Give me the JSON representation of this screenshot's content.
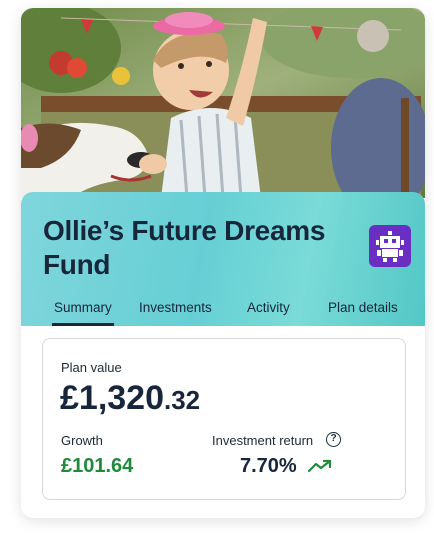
{
  "fund": {
    "title": "Ollie’s Future Dreams Fund",
    "badge_icon": "robot-icon",
    "badge_color": "#6a2fc2"
  },
  "tabs": [
    {
      "label": "Summary",
      "active": true
    },
    {
      "label": "Investments",
      "active": false
    },
    {
      "label": "Activity",
      "active": false
    },
    {
      "label": "Plan details",
      "active": false
    }
  ],
  "summary": {
    "plan_value_label": "Plan value",
    "plan_value_major": "£1,320",
    "plan_value_minor": ".32",
    "growth_label": "Growth",
    "growth_value": "£101.64",
    "growth_color": "#1f8a3a",
    "return_label": "Investment return",
    "return_value": "7.70%",
    "help_icon": "question-circle-icon",
    "trend_icon": "trending-up-icon"
  },
  "colors": {
    "header_teal": "#66cfd5",
    "text_dark": "#17263a"
  }
}
